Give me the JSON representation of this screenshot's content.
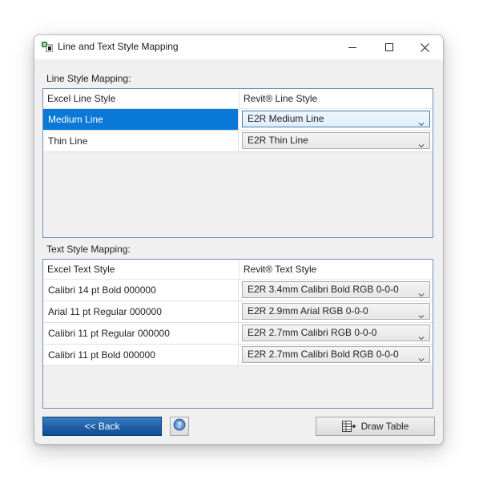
{
  "window": {
    "title": "Line and Text Style Mapping",
    "app_icon": "excel-revit-icon"
  },
  "title_controls": {
    "minimize_icon": "minimize-icon",
    "maximize_icon": "maximize-icon",
    "close_icon": "close-icon"
  },
  "line_mapping": {
    "section_label": "Line Style Mapping:",
    "col_excel": "Excel Line Style",
    "col_revit": "Revit® Line Style",
    "rows": [
      {
        "excel": "Medium Line",
        "revit": "E2R Medium Line",
        "selected": true
      },
      {
        "excel": "Thin Line",
        "revit": "E2R Thin Line",
        "selected": false
      }
    ]
  },
  "text_mapping": {
    "section_label": "Text Style Mapping:",
    "col_excel": "Excel Text Style",
    "col_revit": "Revit® Text Style",
    "rows": [
      {
        "excel": "Calibri  14 pt  Bold 000000",
        "revit": "E2R 3.4mm Calibri Bold RGB 0-0-0"
      },
      {
        "excel": "Arial  11 pt  Regular 000000",
        "revit": "E2R 2.9mm Arial RGB 0-0-0"
      },
      {
        "excel": "Calibri  11 pt  Regular 000000",
        "revit": "E2R 2.7mm Calibri RGB 0-0-0"
      },
      {
        "excel": "Calibri  11 pt  Bold 000000",
        "revit": "E2R 2.7mm Calibri Bold RGB 0-0-0"
      }
    ]
  },
  "footer": {
    "back_label": "<< Back",
    "help_icon": "help-icon",
    "draw_label": "Draw Table",
    "draw_icon": "draw-table-icon"
  },
  "colors": {
    "selection": "#0a78d7",
    "back_button": "#1e5fa6",
    "grid_border": "#6f8fb5",
    "window_bg": "#f0f0f0"
  }
}
